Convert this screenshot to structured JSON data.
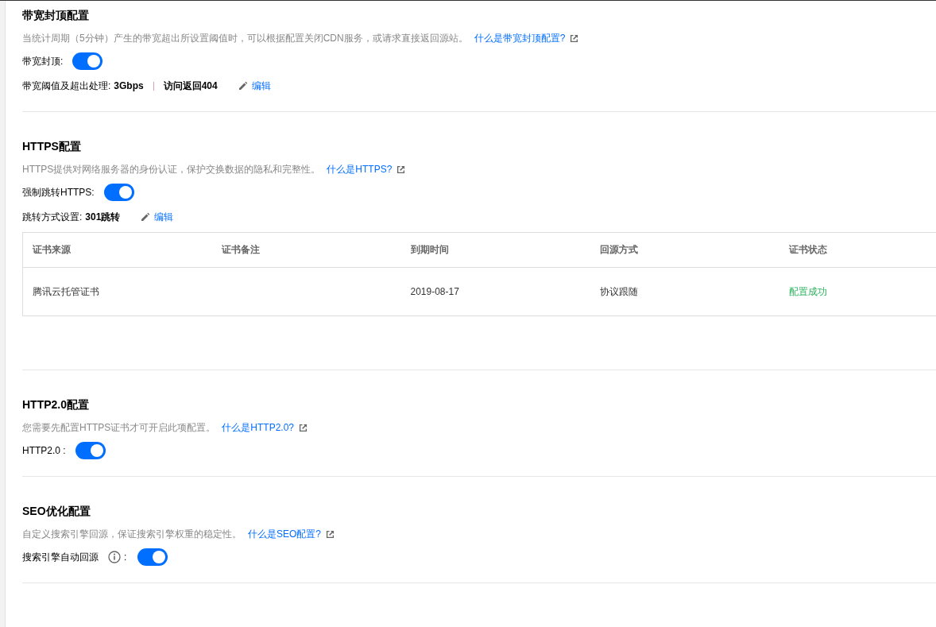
{
  "sections": [
    {
      "title": "带宽封顶配置",
      "description": "当统计周期（5分钟）产生的带宽超出所设置阈值时，可以根据配置关闭CDN服务，或请求直接返回源站。",
      "help_link": "什么是带宽封顶配置?",
      "toggle": {
        "label": "带宽封顶:",
        "info": false,
        "on": true
      },
      "setting": {
        "label": "带宽阈值及超出处理:",
        "values": [
          "3Gbps",
          "访问返回404"
        ],
        "edit": "编辑"
      }
    },
    {
      "title": "HTTPS配置",
      "description": "HTTPS提供对网络服务器的身份认证，保护交换数据的隐私和完整性。",
      "help_link": "什么是HTTPS?",
      "toggle": {
        "label": "强制跳转HTTPS:",
        "info": false,
        "on": true
      },
      "setting": {
        "label": "跳转方式设置:",
        "values": [
          "301跳转"
        ],
        "edit": "编辑"
      },
      "table": {
        "columns": [
          "证书来源",
          "证书备注",
          "到期时间",
          "回源方式",
          "证书状态"
        ],
        "rows": [
          {
            "cells": [
              "腾讯云托管证书",
              "",
              "2019-08-17",
              "协议跟随"
            ],
            "status": {
              "text": "配置成功"
            }
          }
        ]
      }
    },
    {
      "title": "HTTP2.0配置",
      "description": "您需要先配置HTTPS证书才可开启此项配置。",
      "help_link": "什么是HTTP2.0?",
      "toggle": {
        "label": "HTTP2.0 :",
        "info": false,
        "on": true
      }
    },
    {
      "title": "SEO优化配置",
      "description": "自定义搜索引擎回源，保证搜索引擎权重的稳定性。",
      "help_link": "什么是SEO配置?",
      "toggle": {
        "label": "搜索引擎自动回源",
        "info": true,
        "colon": ":",
        "on": true
      }
    }
  ]
}
